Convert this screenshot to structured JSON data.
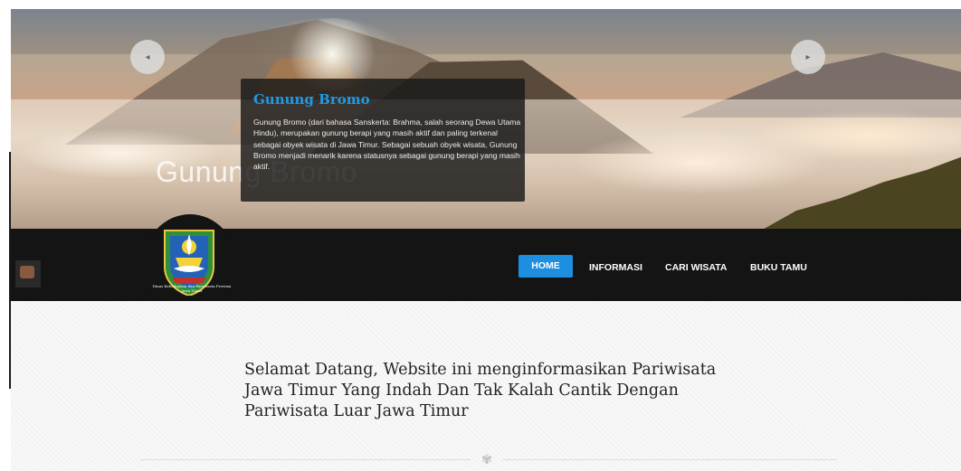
{
  "slider": {
    "slide_title": "Gunung Bromo",
    "caption_title": "Gunung Bromo",
    "caption_text": "Gunung Bromo (dari bahasa Sanskerta: Brahma, salah seorang Dewa Utama Hindu), merupakan gunung berapi yang masih aktif dan paling terkenal sebagai obyek wisata di Jawa Timur. Sebagai sebuah obyek wisata, Gunung Bromo menjadi menarik karena statusnya sebagai gunung berapi yang masih aktif.",
    "prev_icon": "◂",
    "next_icon": "▸"
  },
  "logo": {
    "text": "Dinas Kebudayaan dan Pariwisata Provinsi Jawa Timur"
  },
  "nav": {
    "items": [
      {
        "label": "HOME",
        "active": true
      },
      {
        "label": "INFORMASI",
        "active": false
      },
      {
        "label": "CARI WISATA",
        "active": false
      },
      {
        "label": "BUKU TAMU",
        "active": false
      }
    ]
  },
  "main": {
    "welcome": "Selamat Datang, Website ini menginformasikan Pariwisata Jawa Timur Yang Indah Dan Tak Kalah Cantik Dengan Pariwisata Luar Jawa Timur",
    "divider_icon": "✾"
  },
  "colors": {
    "accent": "#1e8ee0",
    "caption_title": "#1e9ae6",
    "navbar": "#141414"
  }
}
